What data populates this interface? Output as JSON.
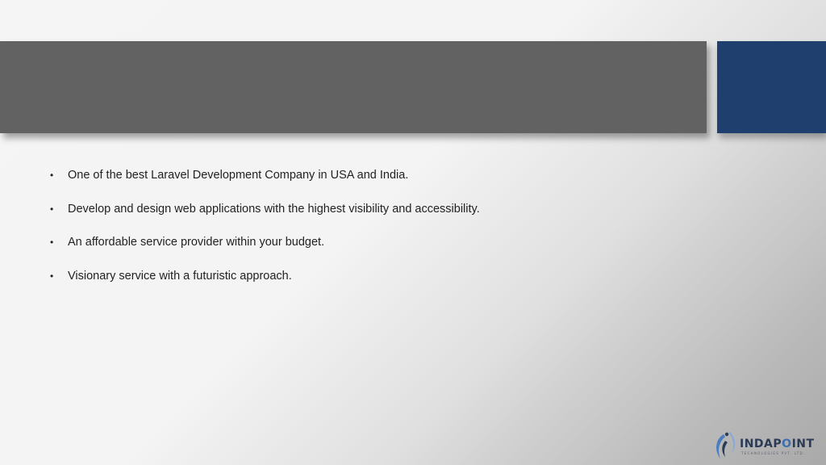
{
  "slide": {
    "title": "",
    "bullet_symbol": "•",
    "bullets": [
      "One of the best Laravel Development Company in USA and India.",
      "Develop and design web applications with the highest visibility and accessibility.",
      "An affordable service provider within your budget.",
      "Visionary service with a futuristic approach."
    ]
  },
  "logo": {
    "word_part1": "INDAP",
    "word_part2": "O",
    "word_part3": "INT",
    "tagline": "TECHNOLOGIES PVT. LTD."
  },
  "colors": {
    "title_bar": "#626262",
    "accent_block": "#1f3f6e",
    "logo_text": "#2b3b55",
    "logo_highlight": "#3d6fb0"
  }
}
